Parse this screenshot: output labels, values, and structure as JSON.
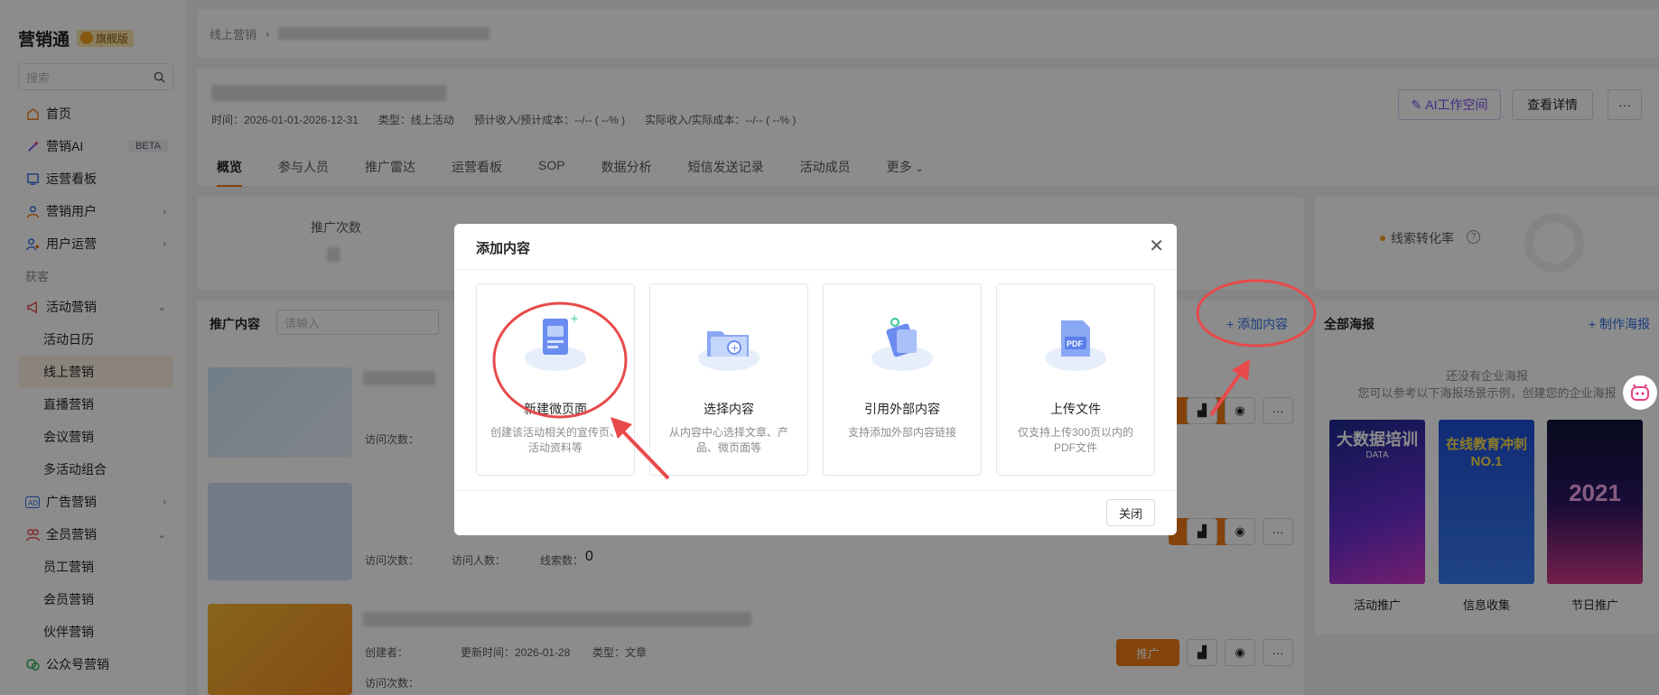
{
  "sidebar": {
    "brand": "营销通",
    "badge": "旗舰版",
    "search_placeholder": "搜索",
    "items": [
      {
        "label": "首页"
      },
      {
        "label": "营销AI",
        "badge": "BETA"
      },
      {
        "label": "运营看板"
      },
      {
        "label": "营销用户"
      },
      {
        "label": "用户运营"
      }
    ],
    "group_label": "获客",
    "activity": {
      "label": "活动营销",
      "subs": [
        "活动日历",
        "线上营销",
        "直播营销",
        "会议营销",
        "多活动组合"
      ]
    },
    "ads": {
      "label": "广告营销"
    },
    "member": {
      "label": "全员营销",
      "subs": [
        "员工营销",
        "会员营销",
        "伙伴营销"
      ]
    },
    "wechat": {
      "label": "公众号营销"
    }
  },
  "breadcrumb": {
    "root": "线上营销"
  },
  "header": {
    "time": "时间：2026-01-01-2026-12-31",
    "type": "类型：线上活动",
    "forecast": "预计收入/预计成本：--/-- ( --% )",
    "actual": "实际收入/实际成本：--/-- ( --% )",
    "ai_button": "AI工作空间",
    "detail_button": "查看详情",
    "more_button": "···"
  },
  "tabs": [
    "概览",
    "参与人员",
    "推广雷达",
    "运营看板",
    "SOP",
    "数据分析",
    "短信发送记录",
    "活动成员",
    "更多"
  ],
  "stats": {
    "promo_count": "推广次数",
    "lead_card": "线索转化率"
  },
  "content": {
    "title": "推广内容",
    "search_placeholder": "请输入",
    "add_content": "添加内容",
    "rows": [
      {
        "visits": "访问次数："
      },
      {
        "visits": "访问次数：",
        "visitors": "访问人数：",
        "leads": "线索数：",
        "lead_value": "0"
      },
      {
        "creator": "创建者：",
        "updated": "更新时间：2026-01-28",
        "kind": "类型：文章",
        "visits": "访问次数："
      }
    ],
    "promo_label": "推广"
  },
  "posters": {
    "title": "全部海报",
    "create": "制作海报",
    "empty1": "还没有企业海报",
    "empty2": "您可以参考以下海报场景示例，创建您的企业海报",
    "items": [
      {
        "label": "活动推广",
        "headline": "大数据培训",
        "sub": "DATA"
      },
      {
        "label": "信息收集",
        "headline": "在线教育冲刺NO.1",
        "sub": ""
      },
      {
        "label": "节日推广",
        "headline": "2021",
        "sub": ""
      }
    ]
  },
  "modal": {
    "title": "添加内容",
    "options": [
      {
        "name": "新建微页面",
        "desc": "创建该活动相关的宣传页、活动资料等"
      },
      {
        "name": "选择内容",
        "desc": "从内容中心选择文章、产品、微页面等"
      },
      {
        "name": "引用外部内容",
        "desc": "支持添加外部内容链接"
      },
      {
        "name": "上传文件",
        "desc": "仅支持上传300页以内的PDF文件"
      }
    ],
    "close_button": "关闭",
    "pdf_label": "PDF"
  },
  "colors": {
    "accent": "#f07a14",
    "link": "#2f6fe4",
    "annotation": "#e84a4a"
  }
}
